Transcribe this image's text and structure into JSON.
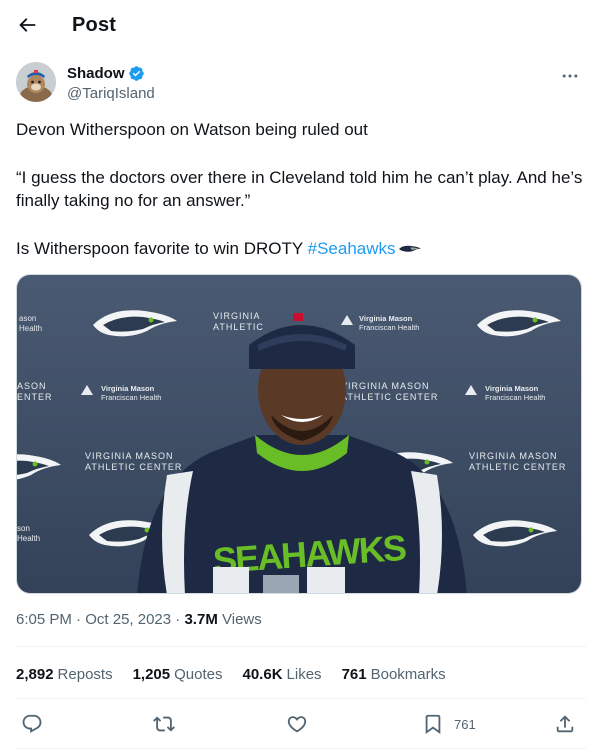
{
  "header": {
    "title": "Post",
    "back_icon": "arrow-left-icon"
  },
  "author": {
    "display_name": "Shadow",
    "handle": "@TariqIsland",
    "verified": true,
    "verified_color": "#1d9bf0",
    "more_icon": "more-horizontal-icon"
  },
  "post": {
    "line1": "Devon Witherspoon on Watson being ruled out",
    "line2": "“I guess the doctors over there in Cleveland told him he can’t play. And he’s finally taking no for an answer.”",
    "line3_prefix": "Is Witherspoon favorite to win DROTY ",
    "hashtag": "#Seahawks",
    "hashtag_color": "#1d9bf0",
    "emoji": "seahawks-logo-icon"
  },
  "media": {
    "backdrop_sponsor_1": "Virginia Mason",
    "backdrop_sponsor_2": "Franciscan Health",
    "backdrop_venue_1": "VIRGINIA MASON",
    "backdrop_venue_2": "ATHLETIC CENTER",
    "backdrop_partial_1": "VIRGINIA",
    "backdrop_partial_2": "ATHLETIC",
    "backdrop_edge_1": "ason",
    "backdrop_edge_2": "Health",
    "backdrop_edge_3": "ASON",
    "backdrop_edge_4": "ENTER",
    "backdrop_edge_5": "son",
    "backdrop_edge_6": "Health",
    "hoodie_text": "SEAHAWKS",
    "backdrop_color": "#3a4a61",
    "hoodie_color": "#1e2a44",
    "accent_color": "#69be28"
  },
  "meta": {
    "time": "6:05 PM",
    "separator": "·",
    "date": "Oct 25, 2023",
    "views_count": "3.7M",
    "views_label": "Views"
  },
  "stats": [
    {
      "num": "2,892",
      "label": "Reposts"
    },
    {
      "num": "1,205",
      "label": "Quotes"
    },
    {
      "num": "40.6K",
      "label": "Likes"
    },
    {
      "num": "761",
      "label": "Bookmarks"
    }
  ],
  "actions": {
    "reply_icon": "reply-icon",
    "repost_icon": "repost-icon",
    "like_icon": "heart-icon",
    "bookmark_icon": "bookmark-icon",
    "bookmark_count": "761",
    "share_icon": "share-icon"
  }
}
